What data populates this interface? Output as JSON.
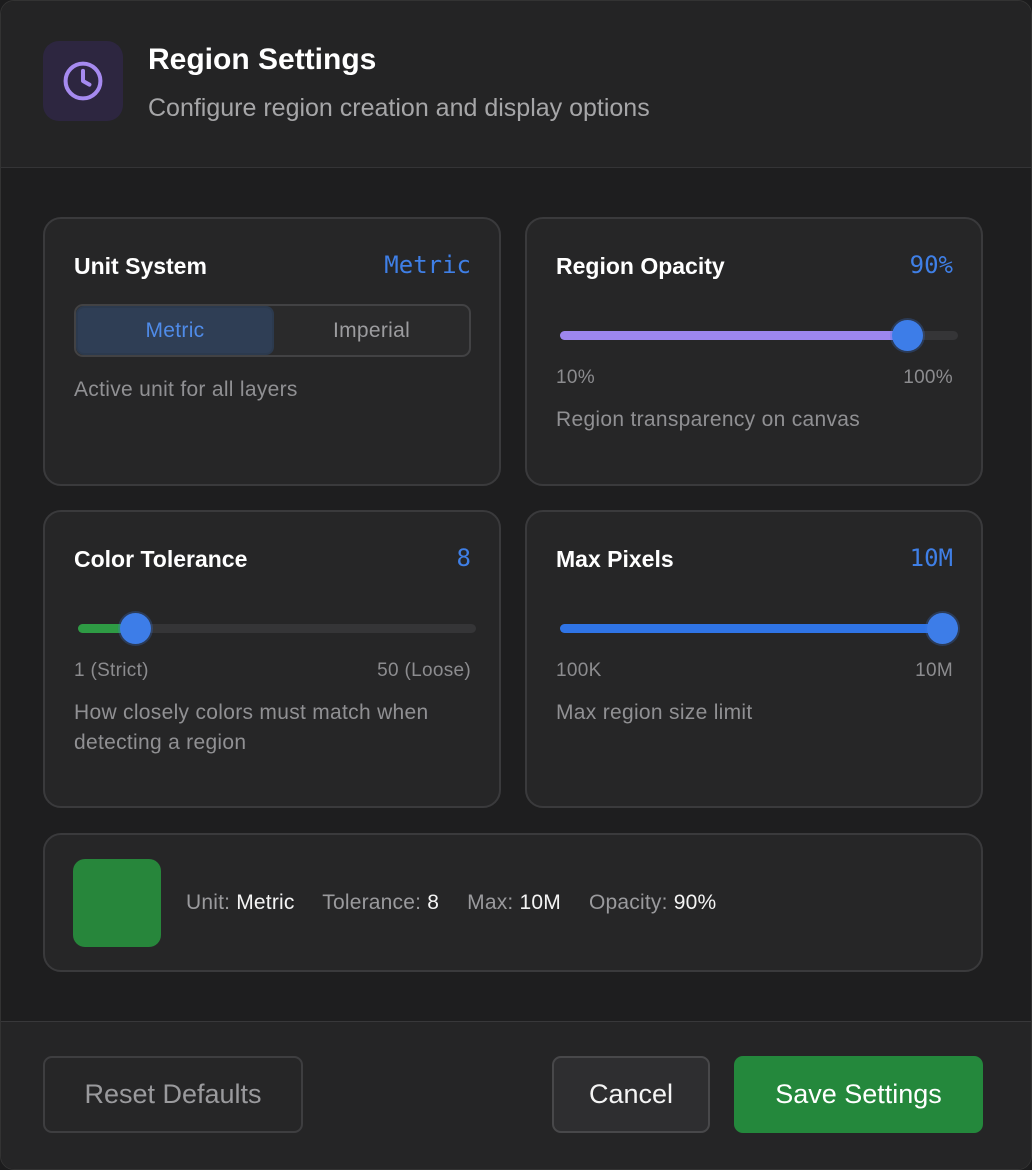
{
  "header": {
    "title": "Region Settings",
    "subtitle": "Configure region creation and display options",
    "icon": "clock-icon",
    "icon_color": "#a68af0"
  },
  "unit_system": {
    "title": "Unit System",
    "value": "Metric",
    "options": [
      "Metric",
      "Imperial"
    ],
    "selected": "Metric",
    "description": "Active unit for all layers"
  },
  "opacity": {
    "title": "Region Opacity",
    "value": "90%",
    "min_label": "10%",
    "max_label": "100%",
    "level": 0.9,
    "fill_color": "#9d86ee",
    "description": "Region transparency on canvas"
  },
  "tolerance": {
    "title": "Color Tolerance",
    "value": "8",
    "min_label": "1 (Strict)",
    "max_label": "50 (Loose)",
    "level": 8,
    "min": 1,
    "max": 50,
    "fill_color": "#2e9b44",
    "description": "How closely colors must match when detecting a region"
  },
  "max_pixels": {
    "title": "Max Pixels",
    "value": "10M",
    "min_label": "100K",
    "max_label": "10M",
    "level": 1.0,
    "fill_color": "#2f74e6",
    "description": "Max region size limit"
  },
  "summary": {
    "swatch_color": "#27863b",
    "unit_label": "Unit:",
    "unit_value": "Metric",
    "tolerance_label": "Tolerance:",
    "tolerance_value": "8",
    "max_label": "Max:",
    "max_value": "10M",
    "opacity_label": "Opacity:",
    "opacity_value": "90%"
  },
  "footer": {
    "reset_label": "Reset Defaults",
    "cancel_label": "Cancel",
    "save_label": "Save Settings"
  }
}
